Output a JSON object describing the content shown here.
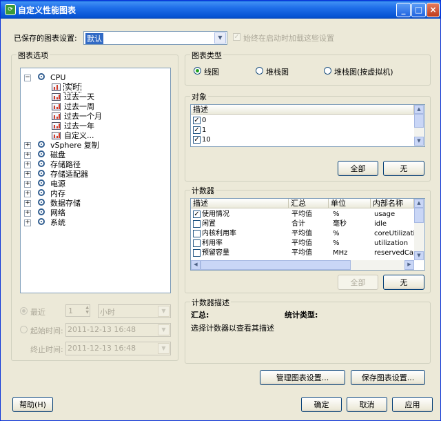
{
  "window": {
    "title": "自定义性能图表"
  },
  "saved_settings": {
    "label": "已保存的图表设置:",
    "value": "默认",
    "checkbox_label": "始终在启动时加载这些设置",
    "checked": true
  },
  "chart_options": {
    "title": "图表选项",
    "tree": [
      {
        "label": "CPU",
        "expanded": true,
        "children": [
          "实时",
          "过去一天",
          "过去一周",
          "过去一个月",
          "过去一年",
          "自定义..."
        ]
      },
      {
        "label": "vSphere 复制"
      },
      {
        "label": "磁盘"
      },
      {
        "label": "存储路径"
      },
      {
        "label": "存储适配器"
      },
      {
        "label": "电源"
      },
      {
        "label": "内存"
      },
      {
        "label": "数据存储"
      },
      {
        "label": "网络"
      },
      {
        "label": "系统"
      }
    ],
    "recent_label": "最近",
    "recent_value": "1",
    "recent_unit": "小时",
    "start_label": "起始时间:",
    "start_value": "2011-12-13 16:48",
    "end_label": "终止时间:",
    "end_value": "2011-12-13 16:48"
  },
  "chart_type": {
    "title": "图表类型",
    "options": [
      "线图",
      "堆栈图",
      "堆栈图(按虚拟机)"
    ],
    "selected": "线图"
  },
  "objects": {
    "title": "对象",
    "column": "描述",
    "rows": [
      {
        "label": "0",
        "checked": true
      },
      {
        "label": "1",
        "checked": true
      },
      {
        "label": "10",
        "checked": true
      }
    ],
    "all_button": "全部",
    "none_button": "无"
  },
  "counters": {
    "title": "计数器",
    "columns": [
      "描述",
      "汇总",
      "单位",
      "内部名称"
    ],
    "rows": [
      {
        "desc": "使用情况",
        "checked": true,
        "rollup": "平均值",
        "unit": "%",
        "internal": "usage"
      },
      {
        "desc": "闲置",
        "checked": false,
        "rollup": "合计",
        "unit": "毫秒",
        "internal": "idle"
      },
      {
        "desc": "内核利用率",
        "checked": false,
        "rollup": "平均值",
        "unit": "%",
        "internal": "coreUtilization"
      },
      {
        "desc": "利用率",
        "checked": false,
        "rollup": "平均值",
        "unit": "%",
        "internal": "utilization"
      },
      {
        "desc": "预留容量",
        "checked": false,
        "rollup": "平均值",
        "unit": "MHz",
        "internal": "reservedCapa"
      }
    ],
    "all_button": "全部",
    "none_button": "无"
  },
  "counter_desc": {
    "title": "计数器描述",
    "rollup_label": "汇总:",
    "stat_label": "统计类型:",
    "hint": "选择计数器以查看其描述"
  },
  "buttons": {
    "manage": "管理图表设置...",
    "save": "保存图表设置...",
    "help": "帮助(H)",
    "ok": "确定",
    "cancel": "取消",
    "apply": "应用"
  },
  "colors": {
    "titlebar": "#0553d3",
    "face": "#ece9d8",
    "selection": "#316ac5"
  }
}
